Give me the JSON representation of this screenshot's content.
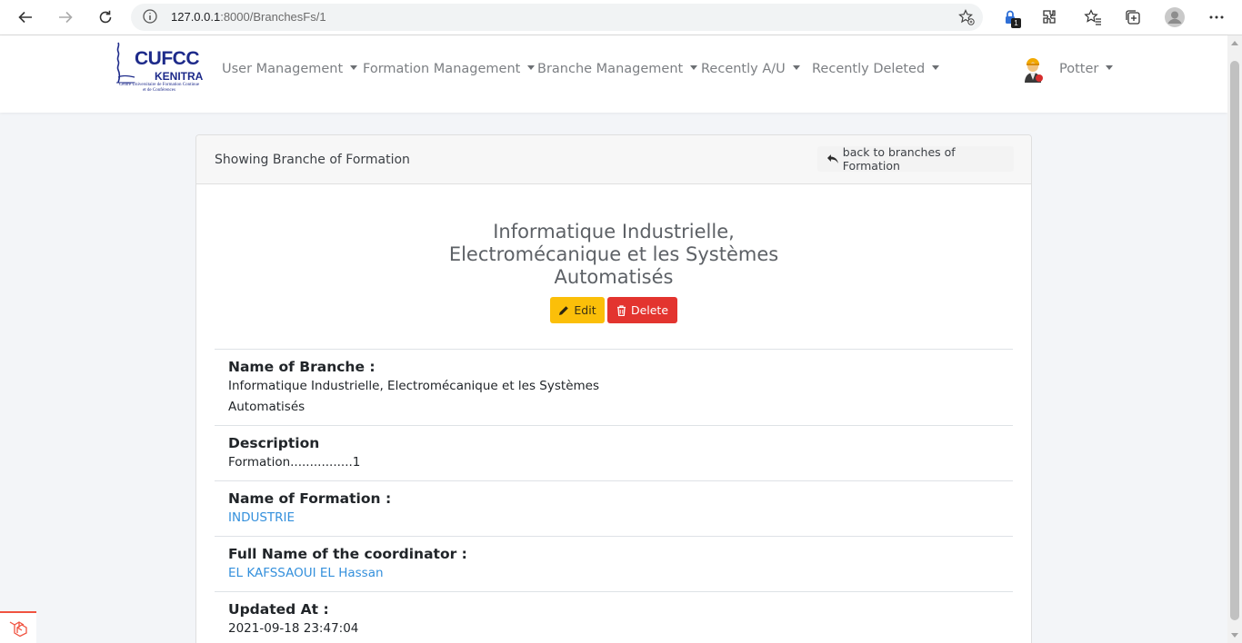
{
  "browser": {
    "url_host": "127.0.0.1",
    "url_rest": ":8000/BranchesFs/1",
    "extension_badge": "1"
  },
  "navbar": {
    "logo": {
      "title": "CUFCC",
      "subtitle": "KENITRA",
      "tagline": "Centre Universitaire de Formation Continue et de Conférences"
    },
    "menus": [
      {
        "label": "User Management"
      },
      {
        "label": "Formation Management"
      },
      {
        "label": "Branche Management"
      },
      {
        "label": "Recently A/U"
      },
      {
        "label": "Recently Deleted"
      }
    ],
    "user": "Potter"
  },
  "card": {
    "header_title": "Showing Branche of Formation",
    "back_label": "back to branches of Formation",
    "headline": [
      "Informatique Industrielle,",
      "Electromécanique et les Systèmes",
      "Automatisés"
    ],
    "edit_label": "Edit",
    "delete_label": "Delete",
    "fields": [
      {
        "label": "Name of Branche :",
        "value": [
          "Informatique Industrielle, Electromécanique et les Systèmes",
          "Automatisés"
        ]
      },
      {
        "label": "Description",
        "value": [
          "Formation................1"
        ]
      },
      {
        "label": "Name of Formation :",
        "value": [
          "INDUSTRIE"
        ]
      },
      {
        "label": "Full Name of the coordinator :",
        "value": [
          "EL KAFSSAOUI EL Hassan"
        ]
      },
      {
        "label": "Updated At :",
        "value": [
          "2021-09-18 23:47:04"
        ]
      }
    ]
  },
  "colors": {
    "edit": "#fbbf09",
    "delete": "#e3342f",
    "link": "#3490dc"
  }
}
